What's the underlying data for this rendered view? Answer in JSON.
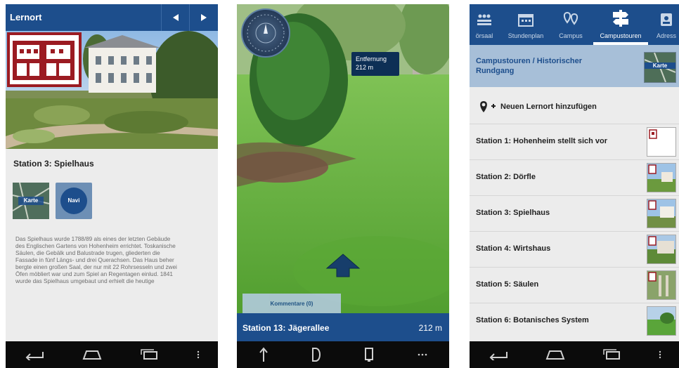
{
  "phone1": {
    "title": "Lernort",
    "station_title": "Station 3: Spielhaus",
    "map_tile_label": "Karte",
    "navi_label": "Navi",
    "description": "Das Spielhaus wurde 1788/89 als eines der letzten Gebäude\ndes Englischen Gartens von Hohenheim errichtet. Toskanische\nSäulen, die Gebälk und Balustrade trugen, gliederten die\nFassade in fünf Längs- und drei Querachsen. Das Haus beher\nbergte einen großen Saal, der nur mit 22 Rohrsesseln und zwei\nÖfen möbliert war und zum Spiel an Regentagen einlud. 1841\nwurde das Spielhaus umgebaut und erhielt die heutige"
  },
  "phone2": {
    "distance_label": "Entfernung",
    "distance_value": "212 m",
    "comments_button": "Kommentare (0)",
    "station_name": "Station 13: Jägerallee",
    "station_distance": "212 m"
  },
  "phone3": {
    "tabs": [
      {
        "label": "örsaal",
        "icon": "lecture-hall-icon"
      },
      {
        "label": "Stundenplan",
        "icon": "calendar-icon"
      },
      {
        "label": "Campus",
        "icon": "map-pins-icon"
      },
      {
        "label": "Campustouren",
        "icon": "signpost-icon"
      },
      {
        "label": "Adress",
        "icon": "contact-icon"
      }
    ],
    "active_tab": "Campustouren",
    "breadcrumb": "Campustouren / Historischer Rundgang",
    "map_thumb_label": "Karte",
    "add_location": "Neuen Lernort hinzufügen",
    "stations": [
      {
        "label": "Station 1: Hohenheim stellt sich vor"
      },
      {
        "label": "Station 2: Dörfle"
      },
      {
        "label": "Station 3: Spielhaus"
      },
      {
        "label": "Station 4: Wirtshaus"
      },
      {
        "label": "Station 5: Säulen"
      },
      {
        "label": "Station 6: Botanisches System"
      }
    ]
  },
  "colors": {
    "brand_blue": "#1d4e8c",
    "logo_red": "#9b1b22",
    "grass": "#5fae3a"
  }
}
